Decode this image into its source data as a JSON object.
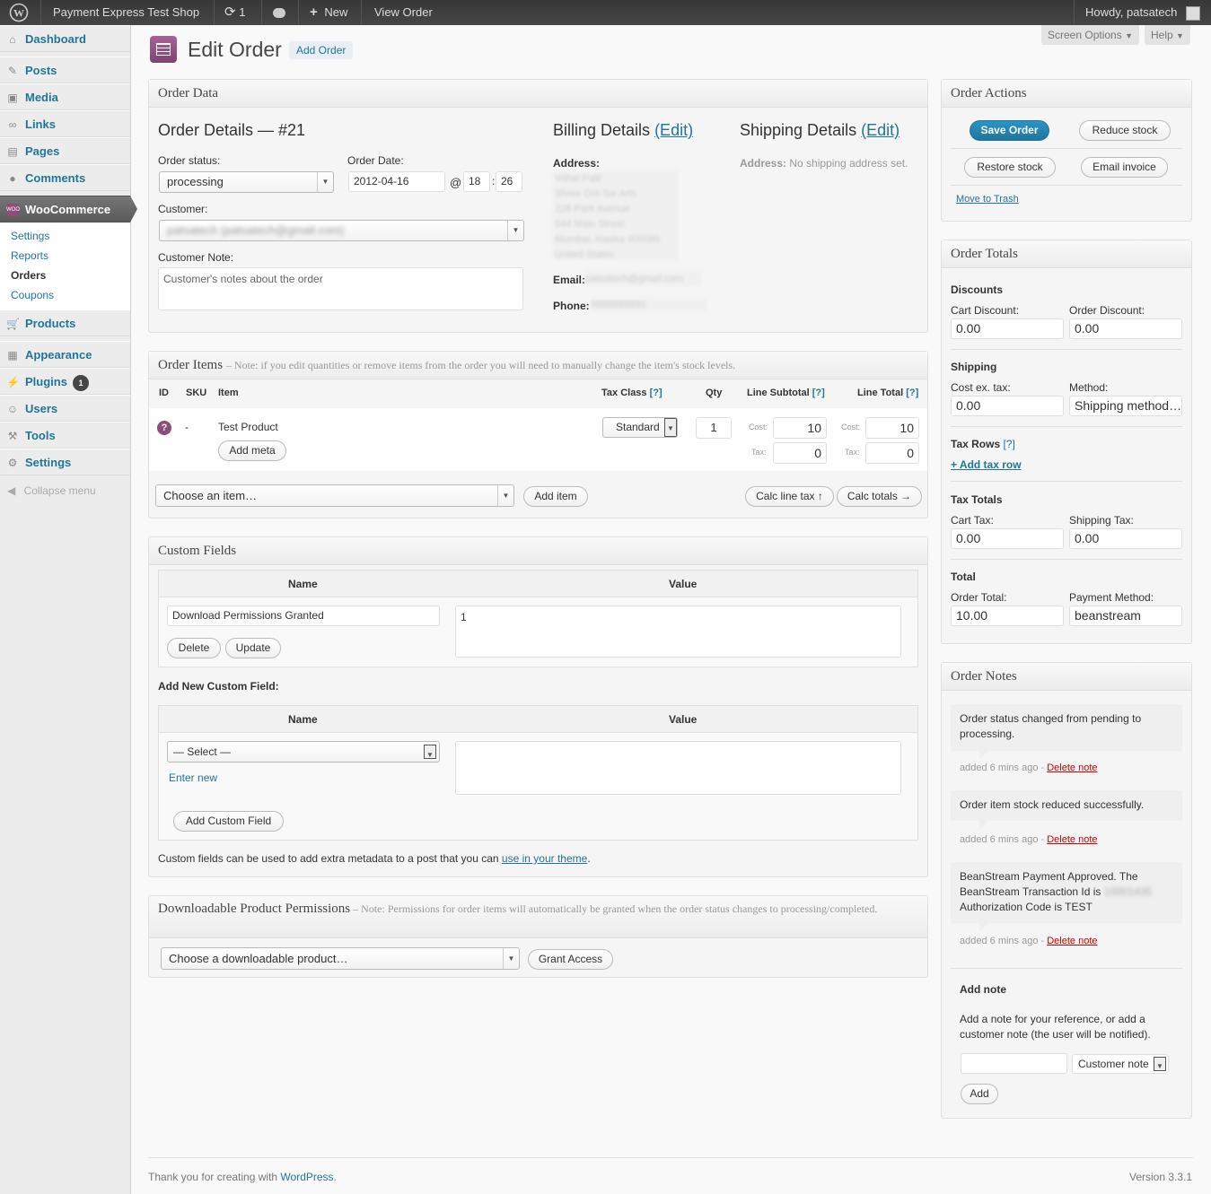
{
  "adminbar": {
    "site_name": "Payment Express Test Shop",
    "updates_count": "1",
    "new_label": "New",
    "view_order_label": "View Order",
    "howdy": "Howdy, patsatech"
  },
  "sidebar": {
    "dashboard": "Dashboard",
    "posts": "Posts",
    "media": "Media",
    "links": "Links",
    "pages": "Pages",
    "comments": "Comments",
    "woocommerce": "WooCommerce",
    "woo_sub": [
      "Settings",
      "Reports",
      "Orders",
      "Coupons"
    ],
    "products": "Products",
    "appearance": "Appearance",
    "plugins": "Plugins",
    "plugins_badge": "1",
    "users": "Users",
    "tools": "Tools",
    "settings": "Settings",
    "collapse": "Collapse menu"
  },
  "header": {
    "title": "Edit Order",
    "add_order": "Add Order",
    "screen_options": "Screen Options",
    "help": "Help"
  },
  "order_data": {
    "box_title": "Order Data",
    "details_title": "Order Details — #21",
    "status_label": "Order status:",
    "status_value": "processing",
    "date_label": "Order Date:",
    "date_value": "2012-04-16",
    "at": "@",
    "hour": "18",
    "colon": ":",
    "minute": "26",
    "customer_label": "Customer:",
    "customer_value": "patsatech (patsatech@gmail.com)",
    "note_label": "Customer Note:",
    "note_placeholder": "Customer's notes about the order",
    "billing_title": "Billing Details",
    "edit_link": "(Edit)",
    "address_label": "Address:",
    "billing_address": [
      "Vithal Patil",
      "Shree Om Sai Arts",
      "228 Park Avenue",
      "544 Main Street",
      "Mumbai, Alaska 400089",
      "United States"
    ],
    "email_label": "Email:",
    "email_value": "patsatech@gmail.com",
    "phone_label": "Phone:",
    "phone_value": "9999999999",
    "shipping_title": "Shipping Details",
    "shipping_address_label": "Address:",
    "shipping_address_value": "No shipping address set."
  },
  "order_items": {
    "box_title": "Order Items",
    "box_note": "– Note: if you edit quantities or remove items from the order you will need to manually change the item's stock levels.",
    "col_id": "ID",
    "col_sku": "SKU",
    "col_item": "Item",
    "col_tax_class": "Tax Class",
    "help_link": "[?]",
    "col_qty": "Qty",
    "col_line_subtotal": "Line Subtotal",
    "col_line_total": "Line Total",
    "row": {
      "id_icon": "?",
      "sku": "-",
      "name": "Test Product",
      "add_meta": "Add meta",
      "tax_class": "Standard",
      "qty": "1",
      "cost_label": "Cost:",
      "tax_label": "Tax:",
      "subtotal_cost": "10",
      "subtotal_tax": "0",
      "total_cost": "10",
      "total_tax": "0"
    },
    "choose_item": "Choose an item…",
    "add_item": "Add item",
    "calc_line_tax": "Calc line tax ↑",
    "calc_totals": "Calc totals →"
  },
  "custom_fields": {
    "box_title": "Custom Fields",
    "col_name": "Name",
    "col_value": "Value",
    "field_name": "Download Permissions Granted",
    "field_value": "1",
    "delete": "Delete",
    "update": "Update",
    "add_new_title": "Add New Custom Field:",
    "select_default": "— Select —",
    "enter_new": "Enter new",
    "add_button": "Add Custom Field",
    "help_text": "Custom fields can be used to add extra metadata to a post that you can",
    "help_link": "use in your theme",
    "help_end": "."
  },
  "downloads": {
    "box_title": "Downloadable Product Permissions",
    "box_note": "– Note: Permissions for order items will automatically be granted when the order status changes to processing/completed.",
    "choose": "Choose a downloadable product…",
    "grant": "Grant Access"
  },
  "order_actions": {
    "box_title": "Order Actions",
    "save": "Save Order",
    "reduce_stock": "Reduce stock",
    "restore_stock": "Restore stock",
    "email_invoice": "Email invoice",
    "trash": "Move to Trash"
  },
  "order_totals": {
    "box_title": "Order Totals",
    "discounts": "Discounts",
    "cart_discount_label": "Cart Discount:",
    "cart_discount": "0.00",
    "order_discount_label": "Order Discount:",
    "order_discount": "0.00",
    "shipping": "Shipping",
    "cost_ex_tax_label": "Cost ex. tax:",
    "cost_ex_tax": "0.00",
    "method_label": "Method:",
    "method_value": "Shipping method…",
    "tax_rows": "Tax Rows",
    "help_link": "[?]",
    "add_tax_row": "+ Add tax row",
    "tax_totals": "Tax Totals",
    "cart_tax_label": "Cart Tax:",
    "cart_tax": "0.00",
    "shipping_tax_label": "Shipping Tax:",
    "shipping_tax": "0.00",
    "total": "Total",
    "order_total_label": "Order Total:",
    "order_total": "10.00",
    "payment_method_label": "Payment Method:",
    "payment_method": "beanstream"
  },
  "order_notes": {
    "box_title": "Order Notes",
    "notes": [
      {
        "text": "Order status changed from pending to processing.",
        "meta": "added 6 mins ago -",
        "delete": "Delete note"
      },
      {
        "text": "Order item stock reduced successfully.",
        "meta": "added 6 mins ago -",
        "delete": "Delete note"
      },
      {
        "text_a": "BeanStream Payment Approved. The BeanStream Transaction Id is",
        "text_id": "10001435",
        "text_b": "Authorization Code is TEST",
        "meta": "added 6 mins ago -",
        "delete": "Delete note"
      }
    ],
    "add_note_title": "Add note",
    "add_note_help": "Add a note for your reference, or add a customer note (the user will be notified).",
    "note_type": "Customer note",
    "add_button": "Add"
  },
  "footer": {
    "thanks": "Thank you for creating with",
    "wp_link": "WordPress",
    "dot": ".",
    "version": "Version 3.3.1"
  },
  "colors": {
    "accent": "#21759b",
    "woo_purple": "#8c4d7a",
    "adminbar": "#464646"
  }
}
